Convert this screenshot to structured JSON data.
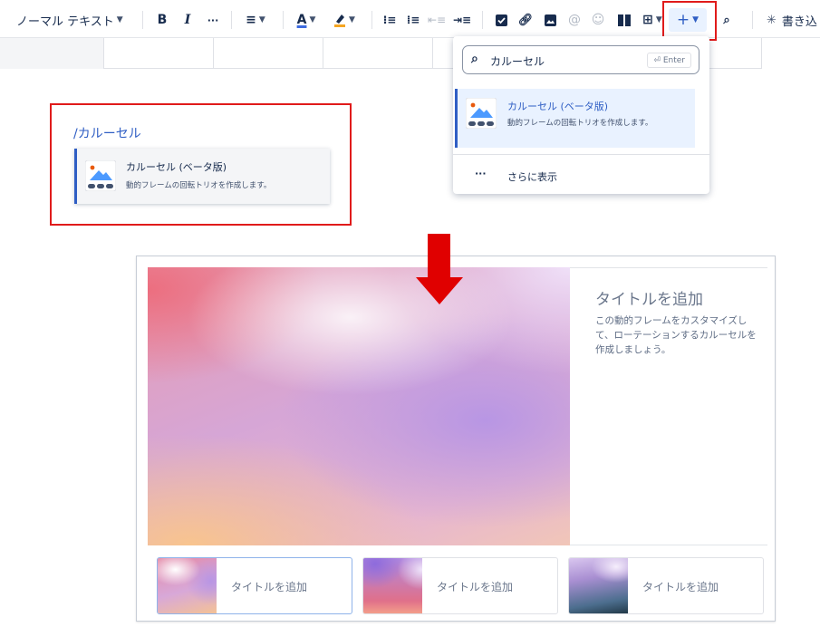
{
  "toolbar": {
    "text_style": "ノーマル テキスト",
    "bold": "B",
    "italic": "I",
    "more": "···",
    "write_label": "書き込"
  },
  "slash_menu": {
    "query": "/カルーセル",
    "item_title": "カルーセル (ベータ版)",
    "item_desc": "動的フレームの回転トリオを作成します。"
  },
  "insert_dropdown": {
    "search_value": "カルーセル",
    "enter_hint": "⏎ Enter",
    "item_title": "カルーセル (ベータ版)",
    "item_desc": "動的フレームの回転トリオを作成します。",
    "more_label": "さらに表示"
  },
  "carousel": {
    "title": "タイトルを追加",
    "description": "この動的フレームをカスタマイズして、ローテーションするカルーセルを作成しましょう。",
    "thumbnails": [
      {
        "label": "タイトルを追加"
      },
      {
        "label": "タイトルを追加"
      },
      {
        "label": "タイトルを追加"
      }
    ]
  },
  "colors": {
    "highlight": "#e01b1b",
    "accent": "#2f5ec4",
    "arrow": "#e00000"
  }
}
